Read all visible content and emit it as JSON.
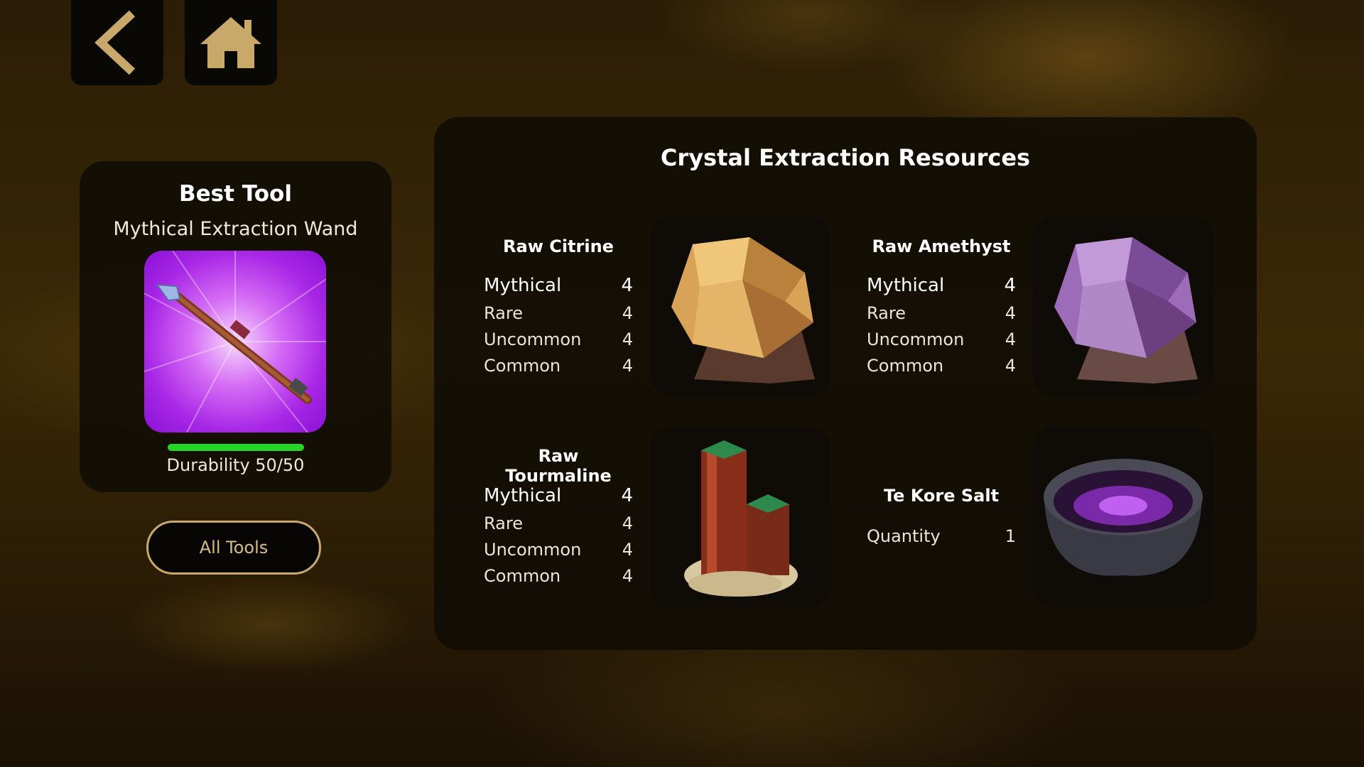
{
  "nav": {
    "back_icon": "chevron-left-icon",
    "home_icon": "home-icon",
    "accent_color": "#c8a96a"
  },
  "best_tool": {
    "title": "Best Tool",
    "name": "Mythical Extraction Wand",
    "image_icon": "extraction-wand-icon",
    "durability_label": "Durability 50/50",
    "durability_fraction": 1.0,
    "durability_color": "#26d626"
  },
  "all_tools_button": {
    "label": "All Tools"
  },
  "resources": {
    "title": "Crystal Extraction Resources",
    "items": [
      {
        "name": "Raw Citrine",
        "image_icon": "citrine-crystal-icon",
        "rows": [
          {
            "label": "Mythical",
            "value": "4"
          },
          {
            "label": "Rare",
            "value": "4"
          },
          {
            "label": "Uncommon",
            "value": "4"
          },
          {
            "label": "Common",
            "value": "4"
          }
        ]
      },
      {
        "name": "Raw Amethyst",
        "image_icon": "amethyst-crystal-icon",
        "rows": [
          {
            "label": "Mythical",
            "value": "4"
          },
          {
            "label": "Rare",
            "value": "4"
          },
          {
            "label": "Uncommon",
            "value": "4"
          },
          {
            "label": "Common",
            "value": "4"
          }
        ]
      },
      {
        "name": "Raw Tourmaline",
        "image_icon": "tourmaline-crystal-icon",
        "rows": [
          {
            "label": "Mythical",
            "value": "4"
          },
          {
            "label": "Rare",
            "value": "4"
          },
          {
            "label": "Uncommon",
            "value": "4"
          },
          {
            "label": "Common",
            "value": "4"
          }
        ]
      },
      {
        "name": "Te Kore Salt",
        "image_icon": "salt-bowl-icon",
        "rows": [
          {
            "label": "Quantity",
            "value": "1"
          }
        ]
      }
    ]
  }
}
